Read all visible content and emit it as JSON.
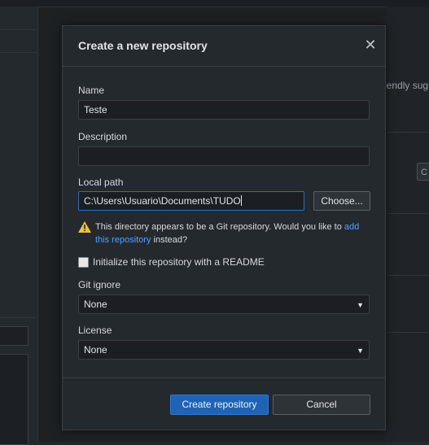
{
  "background": {
    "hint_text": "iendly sug",
    "stub_button_label": "C"
  },
  "dialog": {
    "title": "Create a new repository",
    "close_glyph": "✕",
    "name": {
      "label": "Name",
      "value": "Teste"
    },
    "description": {
      "label": "Description",
      "value": ""
    },
    "local_path": {
      "label": "Local path",
      "value": "C:\\Users\\Usuario\\Documents\\TUDO",
      "choose_label": "Choose..."
    },
    "warning": {
      "icon": "warning-icon",
      "text_before": "This directory appears to be a Git repository. Would you like to ",
      "link_text": "add this repository",
      "text_after": " instead?"
    },
    "readme_checkbox": {
      "label": "Initialize this repository with a README",
      "checked": false
    },
    "git_ignore": {
      "label": "Git ignore",
      "value": "None"
    },
    "license": {
      "label": "License",
      "value": "None"
    },
    "dropdown_glyph": "▼",
    "buttons": {
      "create": "Create repository",
      "cancel": "Cancel"
    }
  },
  "colors": {
    "accent": "#1f63b5",
    "link": "#4ea1ff",
    "warning": "#f2c037",
    "dialog_bg": "#24292e",
    "input_bg": "#1b1f23"
  }
}
